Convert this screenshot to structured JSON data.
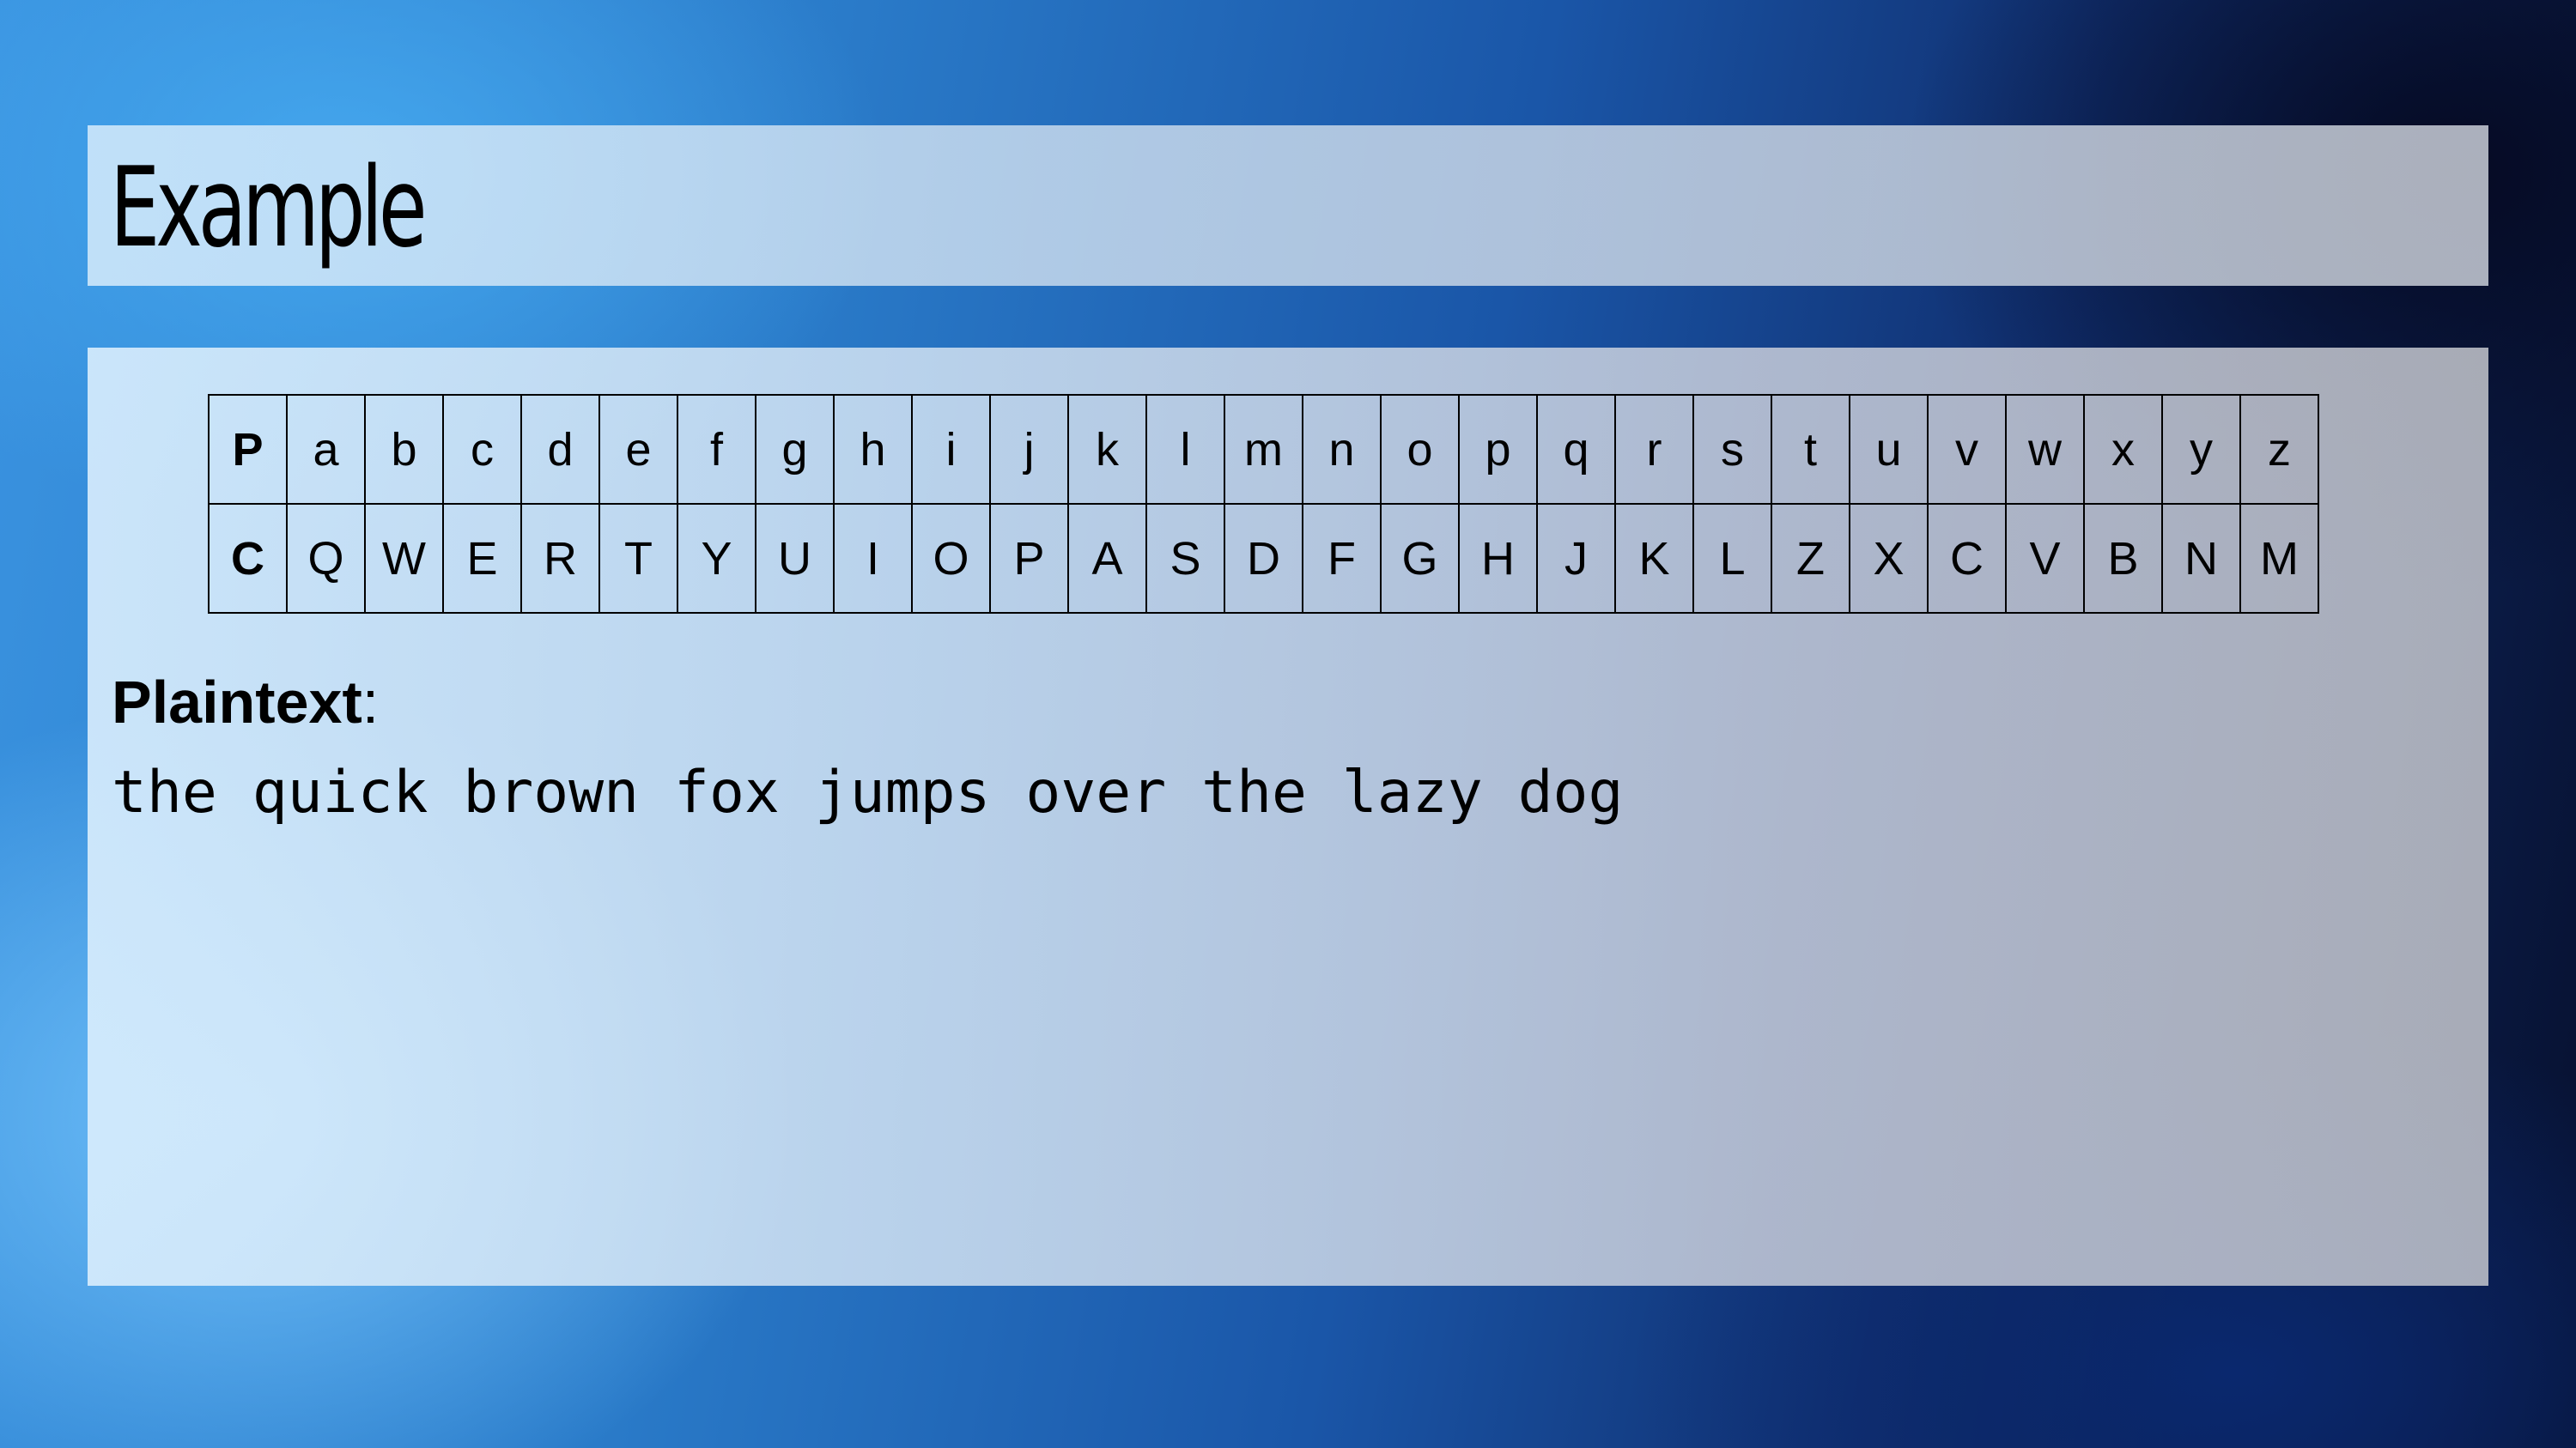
{
  "slide": {
    "title": "Example"
  },
  "cipher_table": {
    "rows": [
      [
        "P",
        "a",
        "b",
        "c",
        "d",
        "e",
        "f",
        "g",
        "h",
        "i",
        "j",
        "k",
        "l",
        "m",
        "n",
        "o",
        "p",
        "q",
        "r",
        "s",
        "t",
        "u",
        "v",
        "w",
        "x",
        "y",
        "z"
      ],
      [
        "C",
        "Q",
        "W",
        "E",
        "R",
        "T",
        "Y",
        "U",
        "I",
        "O",
        "P",
        "A",
        "S",
        "D",
        "F",
        "G",
        "H",
        "J",
        "K",
        "L",
        "Z",
        "X",
        "C",
        "V",
        "B",
        "N",
        "M"
      ]
    ]
  },
  "plaintext": {
    "label": "Plaintext",
    "separator": ":",
    "value": "the quick brown fox jumps over the lazy dog"
  }
}
